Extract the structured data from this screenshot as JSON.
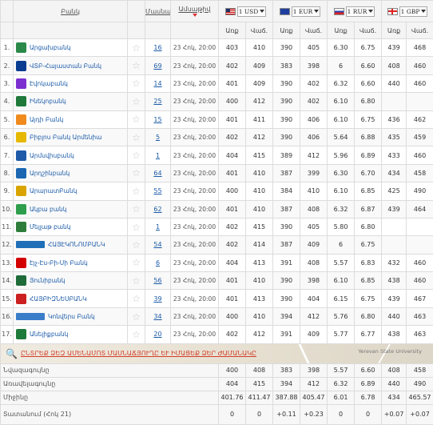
{
  "headers": {
    "bank": "Բանկ",
    "branches": "Մասնաճյուղեր",
    "date": "Ամսաթիվ",
    "buy": "Առք",
    "sell": "Վաճ."
  },
  "currencies": [
    {
      "code": "1 USD",
      "flag": "us-flag-icon"
    },
    {
      "code": "1 EUR",
      "flag": "eu-flag-icon"
    },
    {
      "code": "1 RUR",
      "flag": "ru-flag-icon"
    },
    {
      "code": "1 GBP",
      "flag": "gb-flag-icon"
    }
  ],
  "banks": [
    {
      "n": "1.",
      "name": "Արցախբանկ",
      "logo_color": "#2b8a4a",
      "branches": "16",
      "date": "23 Հոկ, 20:00",
      "rates": [
        "403",
        "410",
        "390",
        "405",
        "6.30",
        "6.75",
        "439",
        "468"
      ]
    },
    {
      "n": "2.",
      "name": "ՎՏԲ-Հայաստան Բանկ",
      "logo_color": "#0a3d91",
      "branches": "69",
      "date": "23 Հոկ, 20:00",
      "rates": [
        "402",
        "409",
        "383",
        "398",
        "6",
        "6.60",
        "408",
        "460"
      ]
    },
    {
      "n": "3.",
      "name": "Էվոկաբանկ",
      "logo_color": "#7b2fd1",
      "branches": "14",
      "date": "23 Հոկ, 20:00",
      "rates": [
        "401",
        "409",
        "390",
        "402",
        "6.32",
        "6.60",
        "440",
        "460"
      ]
    },
    {
      "n": "4.",
      "name": "Ինեկոբանկ",
      "logo_color": "#1f7a3a",
      "branches": "25",
      "date": "23 Հոկ, 20:00",
      "rates": [
        "400",
        "412",
        "390",
        "402",
        "6.10",
        "6.80",
        "",
        ""
      ]
    },
    {
      "n": "5.",
      "name": "Այդի Բանկ",
      "logo_color": "#f08a1d",
      "branches": "15",
      "date": "23 Հոկ, 20:00",
      "rates": [
        "401",
        "411",
        "390",
        "406",
        "6.10",
        "6.75",
        "436",
        "462"
      ]
    },
    {
      "n": "6.",
      "name": "Բիբլոս Բանկ Արմենիա",
      "logo_color": "#e6b800",
      "branches": "5",
      "date": "23 Հոկ, 20:00",
      "rates": [
        "402",
        "412",
        "390",
        "406",
        "5.64",
        "6.88",
        "435",
        "459"
      ]
    },
    {
      "n": "7.",
      "name": "Արմսվիսբանկ",
      "logo_color": "#1e5aa8",
      "branches": "1",
      "date": "23 Հոկ, 20:00",
      "rates": [
        "404",
        "415",
        "389",
        "412",
        "5.96",
        "6.89",
        "433",
        "460"
      ]
    },
    {
      "n": "8.",
      "name": "Արդշինբանկ",
      "logo_color": "#1a66b3",
      "branches": "64",
      "date": "23 Հոկ, 20:00",
      "rates": [
        "401",
        "410",
        "387",
        "399",
        "6.30",
        "6.70",
        "434",
        "458"
      ]
    },
    {
      "n": "9.",
      "name": "ԱրարատԲանկ",
      "logo_color": "#d9a400",
      "branches": "55",
      "date": "23 Հոկ, 20:00",
      "rates": [
        "400",
        "410",
        "384",
        "410",
        "6.10",
        "6.85",
        "425",
        "490"
      ]
    },
    {
      "n": "10.",
      "name": "Ակբա բանկ",
      "logo_color": "#2e9e4c",
      "branches": "62",
      "date": "23 Հոկ, 20:00",
      "rates": [
        "401",
        "410",
        "387",
        "408",
        "6.32",
        "6.87",
        "439",
        "464"
      ]
    },
    {
      "n": "11.",
      "name": "Մելլաթ բանկ",
      "logo_color": "#2f7d3a",
      "branches": "1",
      "date": "23 Հոկ, 20:00",
      "rates": [
        "402",
        "415",
        "390",
        "405",
        "5.80",
        "6.80",
        "",
        ""
      ]
    },
    {
      "n": "12.",
      "name": "ՀԱՅԷԿՈՆՈՄԲԱՆԿ",
      "logo_color": "#1e6fb8",
      "logo_text": "AEB",
      "branches": "54",
      "date": "23 Հոկ, 20:00",
      "rates": [
        "402",
        "414",
        "387",
        "409",
        "6",
        "6.75",
        "",
        ""
      ]
    },
    {
      "n": "13.",
      "name": "Էյչ-Էս-Բի-Սի Բանկ",
      "logo_color": "#d40000",
      "branches": "6",
      "date": "23 Հոկ, 20:00",
      "rates": [
        "404",
        "413",
        "391",
        "408",
        "5.57",
        "6.83",
        "432",
        "460"
      ]
    },
    {
      "n": "14.",
      "name": "Յունիբանկ",
      "logo_color": "#1f6b3a",
      "branches": "56",
      "date": "23 Հոկ, 20:00",
      "rates": [
        "401",
        "410",
        "390",
        "398",
        "6.10",
        "6.85",
        "438",
        "460"
      ]
    },
    {
      "n": "15.",
      "name": "ՀԱՅԲԻԶՆԵՍԲԱՆԿ",
      "logo_color": "#cc1f1f",
      "branches": "39",
      "date": "23 Հոկ, 20:00",
      "rates": [
        "401",
        "413",
        "390",
        "404",
        "6.15",
        "6.75",
        "439",
        "467"
      ]
    },
    {
      "n": "16.",
      "name": "Կոնվերս Բանկ",
      "logo_color": "#3a7dc9",
      "logo_text": "ConverseBank",
      "branches": "34",
      "date": "23 Հոկ, 20:00",
      "rates": [
        "400",
        "410",
        "394",
        "412",
        "5.76",
        "6.80",
        "440",
        "463"
      ]
    },
    {
      "n": "17.",
      "name": "Անելիքբանկ",
      "logo_color": "#1e7a3a",
      "branches": "20",
      "date": "23 Հոկ, 20:00",
      "rates": [
        "402",
        "412",
        "391",
        "409",
        "5.77",
        "6.77",
        "438",
        "463"
      ]
    }
  ],
  "map": {
    "link_text": "ԸՆՏՐԵՔ ՁԵԶ ԱՄԵՆԱՄՈՏ ՄԱՍՆԱՃՅՈՒՂԸ ԵՒ ԻՄԱՑԵՔ ՁԵՐ ԺԱՄԱՆԱԿԸ",
    "place_label": "Yerevan State University"
  },
  "summary": [
    {
      "label": "Նվազագույնը",
      "values": [
        "400",
        "408",
        "383",
        "398",
        "5.57",
        "6.60",
        "408",
        "458"
      ]
    },
    {
      "label": "Առավելագույնը",
      "values": [
        "404",
        "415",
        "394",
        "412",
        "6.32",
        "6.89",
        "440",
        "490"
      ]
    },
    {
      "label": "Միջինը",
      "values": [
        "401.76",
        "411.47",
        "387.88",
        "405.47",
        "6.01",
        "6.78",
        "434",
        "465.57"
      ]
    },
    {
      "label": "Տատանում (Հոկ 21)",
      "values": [
        "0",
        "0",
        "+0.11",
        "+0.23",
        "0",
        "0",
        "+0.07",
        "+0.07"
      ]
    }
  ]
}
